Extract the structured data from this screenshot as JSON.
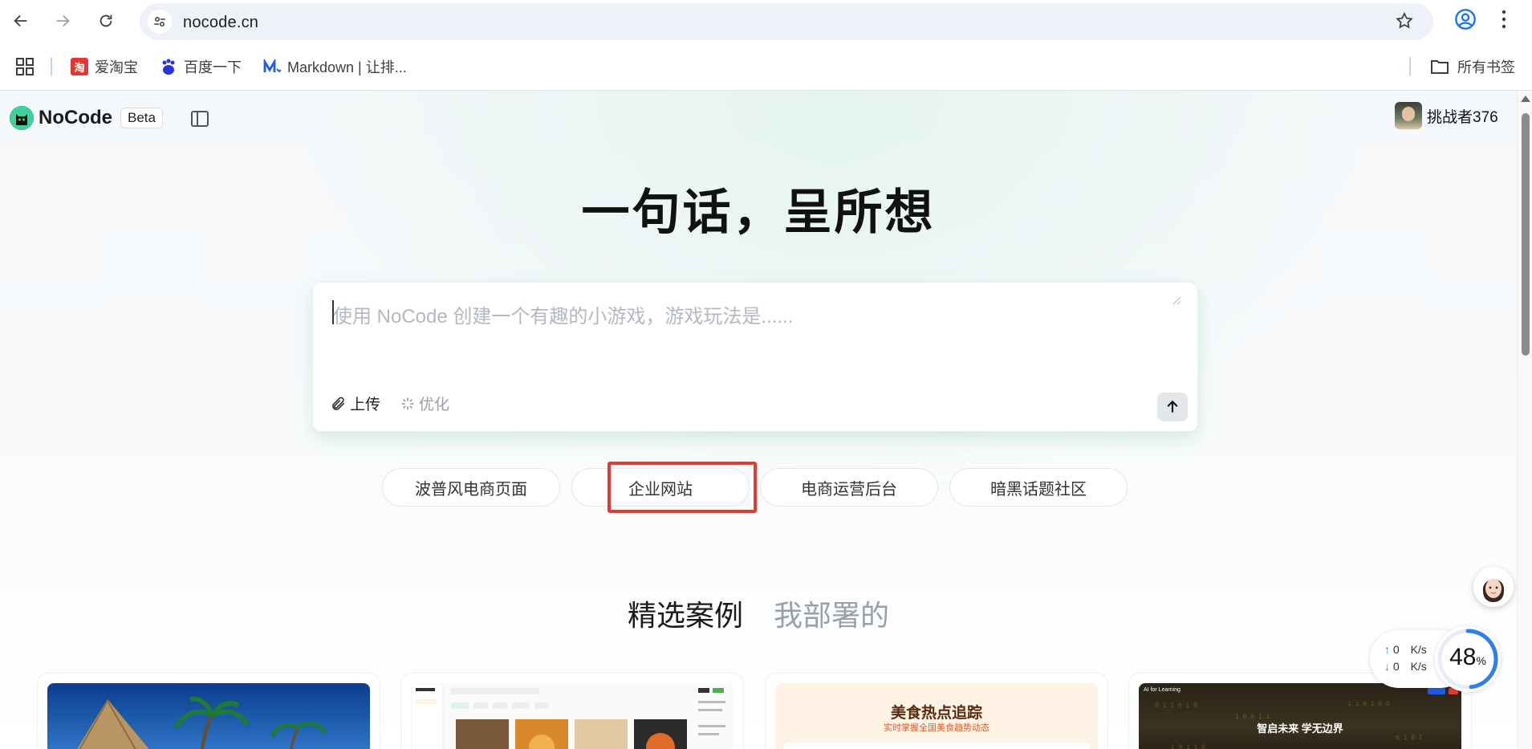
{
  "browser": {
    "url": "nocode.cn",
    "bookmarks": [
      {
        "label": "爱淘宝",
        "icon": "taobao-icon"
      },
      {
        "label": "百度一下",
        "icon": "baidu-icon"
      },
      {
        "label": "Markdown | 让排...",
        "icon": "markdown-icon"
      }
    ],
    "all_bookmarks_label": "所有书签"
  },
  "app": {
    "logo_text": "NoCode",
    "beta_label": "Beta",
    "user_name": "挑战者376",
    "hero_title": "一句话，呈所想",
    "prompt": {
      "placeholder": "使用 NoCode 创建一个有趣的小游戏，游戏玩法是......",
      "value": "",
      "upload_label": "上传",
      "optimize_label": "优化"
    },
    "chips": [
      "波普风电商页面",
      "企业网站",
      "电商运营后台",
      "暗黑话题社区"
    ],
    "highlighted_chip": "企业网站",
    "tabs": [
      {
        "label": "精选案例",
        "active": true
      },
      {
        "label": "我部署的",
        "active": false
      }
    ],
    "cards": [
      {
        "type": "image",
        "scene": "tropical-beach"
      },
      {
        "type": "image",
        "scene": "food-app-dashboard"
      },
      {
        "type": "text",
        "title": "美食热点追踪",
        "subtitle": "实时掌握全国美食趋势动态"
      },
      {
        "type": "text",
        "title": "智启未来 学无边界",
        "tag": "AI for Learning"
      }
    ]
  },
  "widget": {
    "upload_speed": "0",
    "download_speed": "0",
    "speed_unit": "K/s",
    "percent": "48",
    "percent_unit": "%"
  },
  "colors": {
    "accent_shadow": "#78cdb2",
    "highlight": "#e53935",
    "scrollbar_thumb": "#8c8c8c"
  }
}
